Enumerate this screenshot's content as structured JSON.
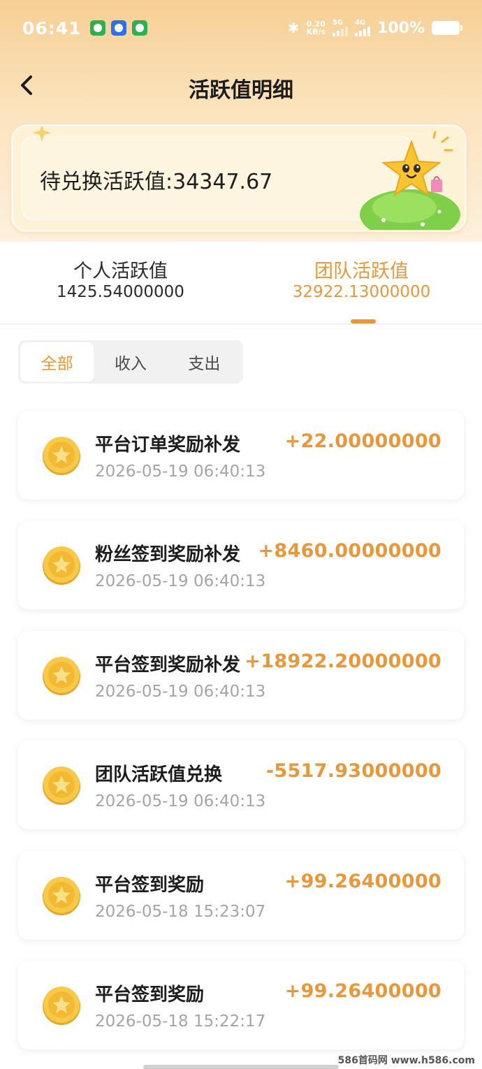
{
  "status_bar": {
    "time": "06:41",
    "net_speed_value": "0.20",
    "net_speed_unit": "KB/s",
    "sim1_label": "5G",
    "sim2_label": "4G",
    "battery": "100%"
  },
  "nav": {
    "title": "活跃值明细"
  },
  "balance": {
    "label": "待兑换活跃值:34347.67"
  },
  "tabs": [
    {
      "label": "个人活跃值",
      "value": "1425.54000000",
      "active": false
    },
    {
      "label": "团队活跃值",
      "value": "32922.13000000",
      "active": true
    }
  ],
  "filter": {
    "items": [
      "全部",
      "收入",
      "支出"
    ],
    "selected": "全部"
  },
  "records": [
    {
      "title": "平台订单奖励补发",
      "time": "2026-05-19 06:40:13",
      "amount": "+22.00000000"
    },
    {
      "title": "粉丝签到奖励补发",
      "time": "2026-05-19 06:40:13",
      "amount": "+8460.00000000"
    },
    {
      "title": "平台签到奖励补发",
      "time": "2026-05-19 06:40:13",
      "amount": "+18922.20000000"
    },
    {
      "title": "团队活跃值兑换",
      "time": "2026-05-19 06:40:13",
      "amount": "-5517.93000000"
    },
    {
      "title": "平台签到奖励",
      "time": "2026-05-18 15:23:07",
      "amount": "+99.26400000"
    },
    {
      "title": "平台签到奖励",
      "time": "2026-05-18 15:22:17",
      "amount": "+99.26400000"
    }
  ],
  "watermark": "586首码网 www.h586.com",
  "colors": {
    "accent": "#e8983a",
    "header_bg": "#f6cf94"
  }
}
